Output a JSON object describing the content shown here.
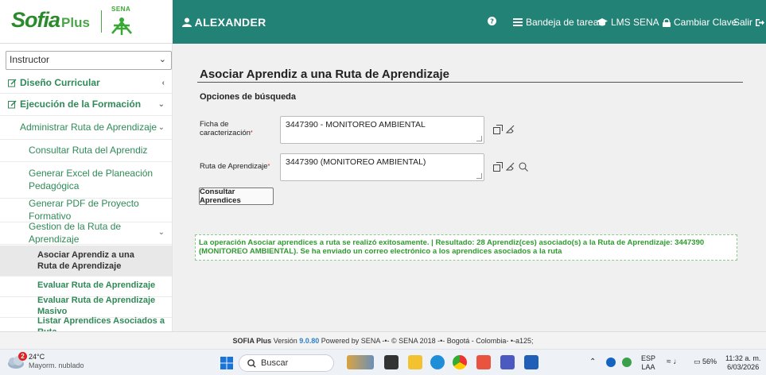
{
  "header": {
    "logo_text": "Sofia",
    "logo_plus": "Plus",
    "sena_word": "SENA",
    "user": "ALEXANDER",
    "help_icon": "question-circle-icon",
    "tasks": "Bandeja de tareas",
    "lms": "LMS SENA",
    "change_password": "Cambiar Clave",
    "logout": "Salir",
    "nav_color": "#238276"
  },
  "sidebar": {
    "role": "Instructor",
    "items": [
      {
        "label": "Diseño Curricular"
      },
      {
        "label": "Ejecución de la Formación"
      },
      {
        "label": "Administrar Ruta de Aprendizaje"
      },
      {
        "label": "Consultar Ruta del Aprendiz"
      },
      {
        "label": "Generar Excel de Planeación Pedagógica"
      },
      {
        "label": "Generar PDF de Proyecto Formativo"
      },
      {
        "label": "Gestion de la Ruta de Aprendizaje"
      },
      {
        "label": "Asociar Aprendiz a una Ruta de Aprendizaje"
      },
      {
        "label": "Evaluar Ruta de Aprendizaje"
      },
      {
        "label": "Evaluar Ruta de Aprendizaje Masivo"
      },
      {
        "label": "Listar Aprendices Asociados a Ruta"
      }
    ]
  },
  "main": {
    "title": "Asociar Aprendiz a una Ruta de Aprendizaje",
    "options_title": "Opciones de búsqueda",
    "ficha_label": "Ficha de caracterización",
    "ficha_value": "3447390 - MONITOREO AMBIENTAL",
    "ruta_label": "Ruta de Aprendizaje",
    "ruta_value": "3447390 (MONITOREO AMBIENTAL)",
    "consult_button": "Consultar Aprendices",
    "success_message": "La operación Asociar aprendices a ruta se realizó exitosamente. | Resultado: 28 Aprendiz(ces) asociado(s) a la Ruta de Aprendizaje: 3447390 (MONITOREO AMBIENTAL). Se ha enviado un correo electrónico a los aprendices asociados a la ruta",
    "success_color": "#2e9b2e"
  },
  "footer": {
    "brand": "SOFIA Plus",
    "version_prefix": "Versión",
    "version": "9.0.80",
    "rest": "Powered by SENA -•- © SENA 2018 -•- Bogotá - Colombia- •-a125;"
  },
  "taskbar": {
    "badge": "2",
    "temperature": "24°C",
    "weather": "Mayorm. nublado",
    "search": "Buscar",
    "lang1": "ESP",
    "lang2": "LAA",
    "battery": "56%",
    "time": "11:32 a. m.",
    "date": "6/03/2026"
  }
}
